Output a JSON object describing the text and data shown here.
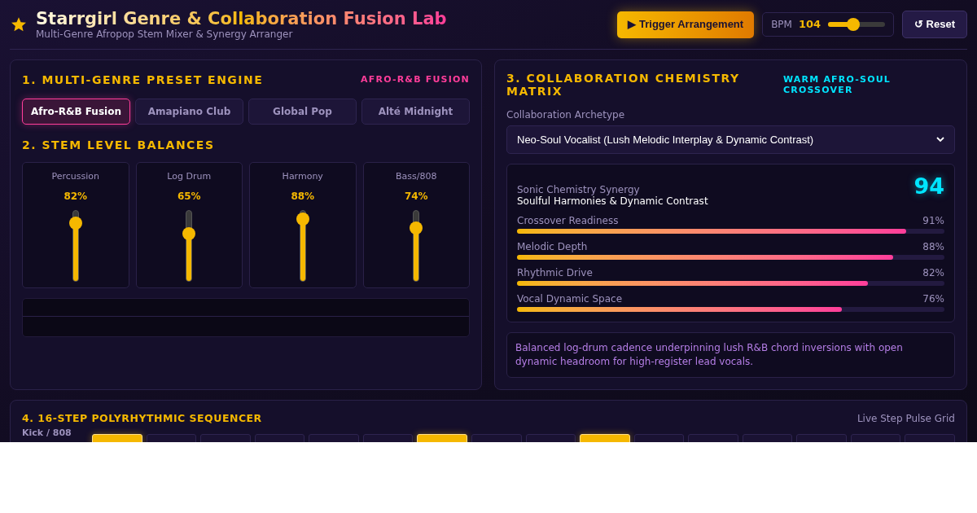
{
  "header": {
    "title": "Starrgirl Genre & Collaboration Fusion Lab",
    "subtitle": "Multi-Genre Afropop Stem Mixer & Synergy Arranger",
    "trigger_button": "▶ Trigger Arrangement",
    "bpm": {
      "label": "BPM",
      "value": "104",
      "level": 0.44
    },
    "reset_button": "↺ Reset"
  },
  "preset_engine": {
    "title": "1. MULTI-GENRE PRESET ENGINE",
    "badge": "AFRO-R&B FUSION",
    "presets": [
      {
        "label": "Afro-R&B Fusion",
        "selected": true
      },
      {
        "label": "Amapiano Club",
        "selected": false
      },
      {
        "label": "Global Pop",
        "selected": false
      },
      {
        "label": "Alté Midnight",
        "selected": false
      }
    ]
  },
  "stem_levels": {
    "title": "2. STEM LEVEL BALANCES",
    "stems": [
      {
        "name": "Percussion",
        "reading": "82%",
        "level": 0.82
      },
      {
        "name": "Log Drum",
        "reading": "65%",
        "level": 0.65
      },
      {
        "name": "Harmony",
        "reading": "88%",
        "level": 0.88
      },
      {
        "name": "Bass/808",
        "reading": "74%",
        "level": 0.74
      }
    ]
  },
  "chemistry": {
    "title": "3. COLLABORATION CHEMISTRY MATRIX",
    "badge": "WARM AFRO-SOUL CROSSOVER",
    "archetype_label": "Collaboration Archetype",
    "archetype_value": "Neo-Soul Vocalist (Lush Melodic Interplay & Dynamic Contrast)",
    "synergy_label": "Sonic Chemistry Synergy",
    "synergy_subtitle": "Soulful Harmonies & Dynamic Contrast",
    "score": "94",
    "metrics": [
      {
        "name": "Crossover Readiness",
        "reading": "91%",
        "level": 0.91
      },
      {
        "name": "Melodic Depth",
        "reading": "88%",
        "level": 0.88
      },
      {
        "name": "Rhythmic Drive",
        "reading": "82%",
        "level": 0.82
      },
      {
        "name": "Vocal Dynamic Space",
        "reading": "76%",
        "level": 0.76
      }
    ],
    "description": "Balanced log-drum cadence underpinning lush R&B chord inversions with open dynamic headroom for high-register lead vocals."
  },
  "sequencer": {
    "title": "4. 16-STEP POLYRHYTHMIC SEQUENCER",
    "caption": "Live Step Pulse Grid",
    "tracks": [
      {
        "name": "Kick / 808",
        "steps": [
          true,
          false,
          false,
          false,
          false,
          false,
          true,
          false,
          false,
          true,
          false,
          false,
          false,
          false,
          false,
          false
        ]
      }
    ]
  }
}
